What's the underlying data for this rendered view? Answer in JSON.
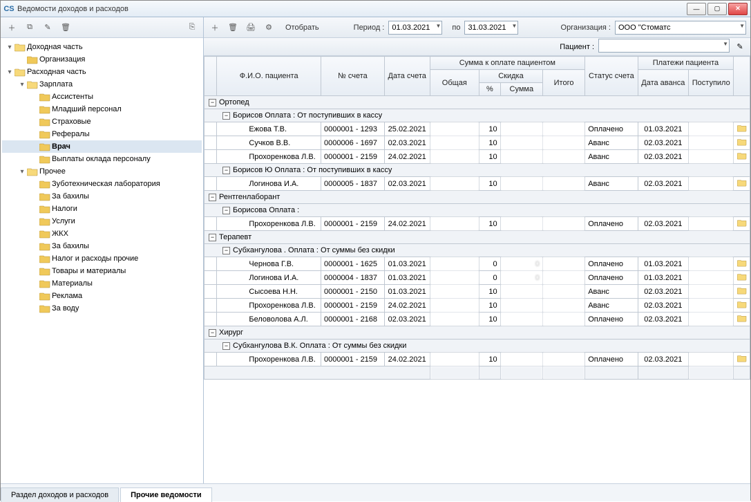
{
  "window": {
    "title": "Ведомости доходов и расходов",
    "app_icon": "CS"
  },
  "left_toolbar": {
    "add": "add-icon",
    "add_child": "add-child-icon",
    "edit": "edit-icon",
    "delete": "delete-icon",
    "copy": "copy-icon"
  },
  "tree": [
    {
      "depth": 0,
      "exp": "-",
      "label": "Доходная часть",
      "sel": false,
      "open": true
    },
    {
      "depth": 1,
      "exp": " ",
      "label": "Организация",
      "sel": false
    },
    {
      "depth": 0,
      "exp": "-",
      "label": "Расходная часть",
      "sel": false,
      "open": true
    },
    {
      "depth": 1,
      "exp": "-",
      "label": "Зарплата",
      "sel": false,
      "open": true
    },
    {
      "depth": 2,
      "exp": " ",
      "label": "Ассистенты",
      "sel": false
    },
    {
      "depth": 2,
      "exp": " ",
      "label": "Младший персонал",
      "sel": false
    },
    {
      "depth": 2,
      "exp": " ",
      "label": "Страховые",
      "sel": false
    },
    {
      "depth": 2,
      "exp": " ",
      "label": "Рефералы",
      "sel": false
    },
    {
      "depth": 2,
      "exp": " ",
      "label": "Врач",
      "sel": true
    },
    {
      "depth": 2,
      "exp": " ",
      "label": "Выплаты оклада персоналу",
      "sel": false
    },
    {
      "depth": 1,
      "exp": "-",
      "label": "Прочее",
      "sel": false,
      "open": true
    },
    {
      "depth": 2,
      "exp": " ",
      "label": "Зуботехническая лаборатория",
      "sel": false
    },
    {
      "depth": 2,
      "exp": " ",
      "label": "За бахилы",
      "sel": false
    },
    {
      "depth": 2,
      "exp": " ",
      "label": "Налоги",
      "sel": false
    },
    {
      "depth": 2,
      "exp": " ",
      "label": "Услуги",
      "sel": false
    },
    {
      "depth": 2,
      "exp": " ",
      "label": "ЖКХ",
      "sel": false
    },
    {
      "depth": 2,
      "exp": " ",
      "label": "За бахилы",
      "sel": false
    },
    {
      "depth": 2,
      "exp": " ",
      "label": "Налог и расходы прочие",
      "sel": false
    },
    {
      "depth": 2,
      "exp": " ",
      "label": "Товары и материалы",
      "sel": false
    },
    {
      "depth": 2,
      "exp": " ",
      "label": "Материалы",
      "sel": false
    },
    {
      "depth": 2,
      "exp": " ",
      "label": "Реклама",
      "sel": false
    },
    {
      "depth": 2,
      "exp": " ",
      "label": "За воду",
      "sel": false
    }
  ],
  "right_toolbar": {
    "filter_label": "Отобрать",
    "period_label": "Период :",
    "period_from": "01.03.2021",
    "to_label": "по",
    "period_to": "31.03.2021",
    "org_label": "Организация :",
    "org_value": "ООО \"Стоматс",
    "patient_label": "Пациент :",
    "patient_value": ""
  },
  "columns": {
    "fio": "Ф.И.О. пациента",
    "account": "№ счета",
    "date": "Дата счета",
    "sum_group": "Сумма к оплате пациентом",
    "total": "Общая",
    "disc_group": "Скидка",
    "disc_pct": "%",
    "disc_sum": "Сумма",
    "itogo": "Итого",
    "status": "Статус счета",
    "pay_group": "Платежи пациента",
    "avans_date": "Дата аванса",
    "received": "Поступило"
  },
  "groups": [
    {
      "title": "Ортопед",
      "children": [
        {
          "title": "Борисов          Оплата : От поступивших в кассу",
          "rows": [
            {
              "fio": "Ежова Т.В.",
              "acc": "0000001 - 1293",
              "date": "25.02.2021",
              "total": "",
              "pct": "10",
              "dsum": "",
              "itogo": "",
              "status": "Оплачено",
              "adate": "01.03.2021",
              "recv": ""
            },
            {
              "fio": "Сучков В.В.",
              "acc": "0000006 - 1697",
              "date": "02.03.2021",
              "total": "",
              "pct": "10",
              "dsum": "",
              "itogo": "",
              "status": "Аванс",
              "adate": "02.03.2021",
              "recv": ""
            },
            {
              "fio": "Прохоренкова Л.В.",
              "acc": "0000001 - 2159",
              "date": "24.02.2021",
              "total": "",
              "pct": "10",
              "dsum": "",
              "itogo": "",
              "status": "Аванс",
              "adate": "02.03.2021",
              "recv": ""
            }
          ]
        },
        {
          "title": "Борисов Ю        Оплата : От поступивших в кассу",
          "rows": [
            {
              "fio": "Логинова И.А.",
              "acc": "0000005 - 1837",
              "date": "02.03.2021",
              "total": "",
              "pct": "10",
              "dsum": "",
              "itogo": "",
              "status": "Аванс",
              "adate": "02.03.2021",
              "recv": ""
            }
          ]
        }
      ]
    },
    {
      "title": "Рентгенлаборант",
      "children": [
        {
          "title": "Борисова        Оплата :",
          "rows": [
            {
              "fio": "Прохоренкова Л.В.",
              "acc": "0000001 - 2159",
              "date": "24.02.2021",
              "total": "",
              "pct": "10",
              "dsum": "",
              "itogo": "",
              "status": "Оплачено",
              "adate": "02.03.2021",
              "recv": ""
            }
          ]
        }
      ]
    },
    {
      "title": "Терапевт",
      "current": true,
      "children": [
        {
          "title": "Субхангулова       . Оплата : От суммы без скидки",
          "rows": [
            {
              "fio": "Чернова Г.В.",
              "acc": "0000001 - 1625",
              "date": "01.03.2021",
              "total": "",
              "pct": "0",
              "dsum": "0",
              "itogo": "",
              "status": "Оплачено",
              "adate": "01.03.2021",
              "recv": ""
            },
            {
              "fio": "Логинова И.А.",
              "acc": "0000004 - 1837",
              "date": "01.03.2021",
              "total": "",
              "pct": "0",
              "dsum": "0",
              "itogo": "",
              "status": "Оплачено",
              "adate": "01.03.2021",
              "recv": ""
            },
            {
              "fio": "Сысоева Н.Н.",
              "acc": "0000001 - 2150",
              "date": "01.03.2021",
              "total": "",
              "pct": "10",
              "dsum": "",
              "itogo": "",
              "status": "Аванс",
              "adate": "02.03.2021",
              "recv": ""
            },
            {
              "fio": "Прохоренкова Л.В.",
              "acc": "0000001 - 2159",
              "date": "24.02.2021",
              "total": "",
              "pct": "10",
              "dsum": "",
              "itogo": "",
              "status": "Аванс",
              "adate": "02.03.2021",
              "recv": ""
            },
            {
              "fio": "Беловолова А.Л.",
              "acc": "0000001 - 2168",
              "date": "02.03.2021",
              "total": "",
              "pct": "10",
              "dsum": "",
              "itogo": "",
              "status": "Оплачено",
              "adate": "02.03.2021",
              "recv": ""
            }
          ]
        }
      ]
    },
    {
      "title": "Хирург",
      "children": [
        {
          "title": "Субхангулова В.К. Оплата : От суммы без скидки",
          "rows": [
            {
              "fio": "Прохоренкова Л.В.",
              "acc": "0000001 - 2159",
              "date": "24.02.2021",
              "total": "",
              "pct": "10",
              "dsum": "",
              "itogo": "",
              "status": "Оплачено",
              "adate": "02.03.2021",
              "recv": ""
            }
          ]
        }
      ]
    }
  ],
  "tabs": {
    "a": "Раздел доходов и расходов",
    "b": "Прочие ведомости"
  }
}
